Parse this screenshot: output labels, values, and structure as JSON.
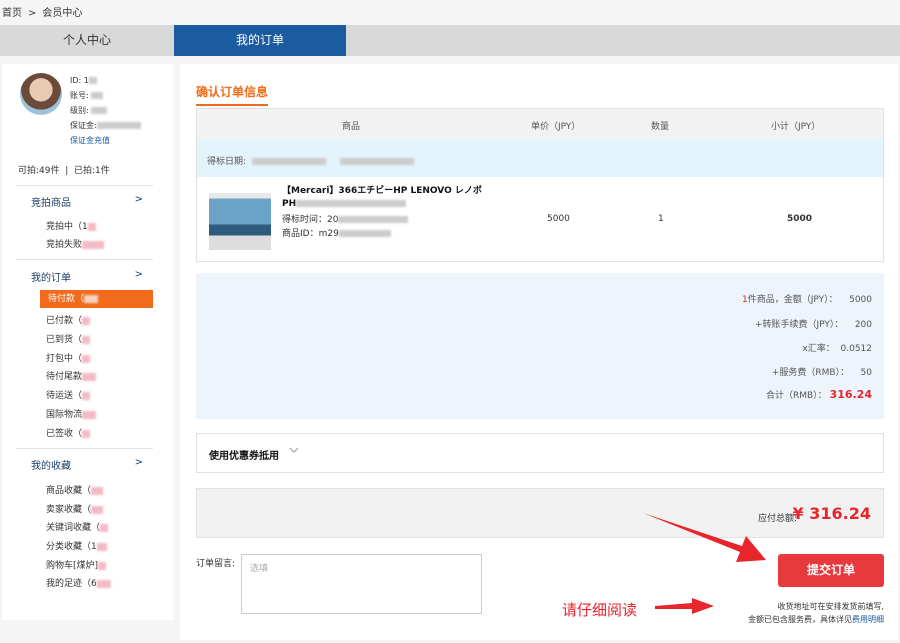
{
  "breadcrumb": {
    "home": "首页",
    "sep": ">",
    "current": "会员中心"
  },
  "tabs": [
    "个人中心",
    "我的订单"
  ],
  "profile": {
    "id_label": "ID:",
    "id_value": "1",
    "account_label": "账号:",
    "level_label": "级别:",
    "deposit_label": "保证金:",
    "deposit_link": "保证金充值",
    "bid_available": "可拍:49件",
    "bid_done": "已拍:1件"
  },
  "menu": {
    "bidding": {
      "title": "竞拍商品",
      "arrow": ">",
      "items": [
        "竞拍中（1",
        "竞拍失败"
      ]
    },
    "orders": {
      "title": "我的订单",
      "arrow": ">",
      "items": [
        "待付款（",
        "已付款（",
        "已到货（",
        "打包中（",
        "待付尾款",
        "待运送（",
        "国际物流",
        "已签收（"
      ]
    },
    "favorites": {
      "title": "我的收藏",
      "arrow": ">",
      "items": [
        "商品收藏（",
        "卖家收藏（",
        "关键词收藏（",
        "分类收藏（1",
        "购物车[煤炉]",
        "我的足迹（6"
      ]
    }
  },
  "order": {
    "section_title": "确认订单信息",
    "headers": {
      "product": "商品",
      "unit_price": "单价（JPY）",
      "qty": "数量",
      "subtotal": "小计（JPY）"
    },
    "date_label": "得标日期:",
    "product": {
      "title_line1": "【Mercari】366エチビーHP LENOVO レノボ",
      "title_line2": "PH",
      "time_label": "得标时间：20",
      "id_label": "商品ID：m29",
      "unit_price": "5000",
      "qty": "1",
      "subtotal": "5000"
    }
  },
  "summary": {
    "item_count": "1",
    "line1_suffix": "件商品，金额（JPY）：",
    "line1_value": "5000",
    "line2_label": "+转账手续费（JPY）：",
    "line2_value": "200",
    "line3_label": "x汇率：",
    "line3_value": "0.0512",
    "line4_label": "+服务费（RMB）：",
    "line4_value": "50",
    "line5_label": "合计（RMB）：",
    "line5_value": "316.24"
  },
  "coupon": {
    "label": "使用优惠券抵用"
  },
  "total": {
    "label": "应付总额:",
    "amount": "¥ 316.24"
  },
  "message": {
    "label": "订单留言:",
    "placeholder": "选填"
  },
  "submit_label": "提交订单",
  "note": {
    "line1": "收货地址可在安排发货前填写,",
    "line2_prefix": "金额已包含服务费，具体详见",
    "link": "费用明细"
  },
  "read_hint": "请仔细阅读",
  "colors": {
    "accent_orange": "#f26b1d",
    "nav_blue": "#1b5ba0",
    "submit_red": "#e8393c",
    "price_red": "#e8242c"
  }
}
